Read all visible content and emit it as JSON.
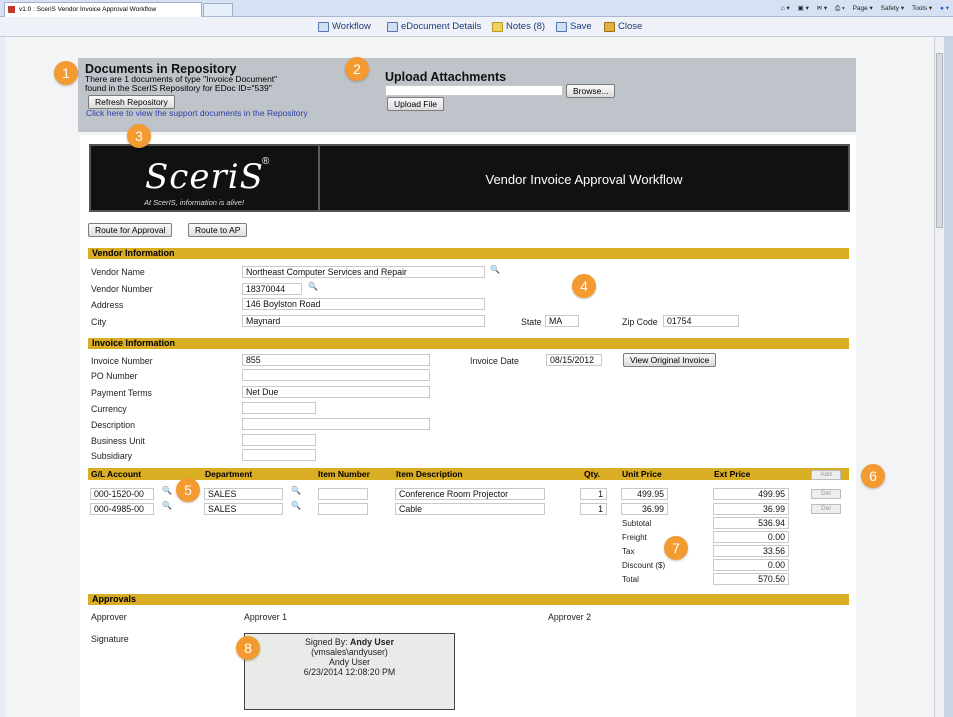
{
  "browser": {
    "tab_title": "v1.0 : SceriS Vendor Invoice Approval Workflow",
    "tools": [
      "Page ▾",
      "Safety ▾",
      "Tools ▾"
    ]
  },
  "toolbar": {
    "workflow": "Workflow",
    "edoc_details": "eDocument Details",
    "notes": "Notes (8)",
    "save": "Save",
    "close": "Close"
  },
  "repository": {
    "title": "Documents in Repository",
    "line1": "There are 1 documents of type \"Invoice Document\"",
    "line2": "found in the ScerIS Repository for EDoc ID=\"539\"",
    "refresh_button": "Refresh Repository",
    "link": "Click here to view the support documents in the Repository",
    "upload_title": "Upload Attachments",
    "browse_button": "Browse...",
    "upload_button": "Upload File"
  },
  "banner": {
    "logo": "SceriS",
    "registered": "®",
    "tagline": "At ScerIS, information is alive!",
    "title": "Vendor Invoice Approval Workflow"
  },
  "actions": {
    "route_approval": "Route for Approval",
    "route_ap": "Route to AP"
  },
  "vendor": {
    "section": "Vendor Information",
    "name_label": "Vendor Name",
    "name": "Northeast Computer Services and Repair",
    "number_label": "Vendor Number",
    "number": "18370044",
    "address_label": "Address",
    "address": "146 Boylston Road",
    "city_label": "City",
    "city": "Maynard",
    "state_label": "State",
    "state": "MA",
    "zip_label": "Zip Code",
    "zip": "01754"
  },
  "invoice": {
    "section": "Invoice Information",
    "number_label": "Invoice Number",
    "number": "855",
    "date_label": "Invoice Date",
    "date": "08/15/2012",
    "view_button": "View Original Invoice",
    "po_label": "PO Number",
    "po": "",
    "terms_label": "Payment Terms",
    "terms": "Net Due",
    "currency_label": "Currency",
    "currency": "",
    "description_label": "Description",
    "description": "",
    "unit_label": "Business Unit",
    "unit": "",
    "subsidiary_label": "Subsidiary",
    "subsidiary": ""
  },
  "lines": {
    "headers": {
      "gl": "G/L Account",
      "dept": "Department",
      "item": "Item Number",
      "desc": "Item Description",
      "qty": "Qty.",
      "unit": "Unit Price",
      "ext": "Ext Price",
      "add": "Add"
    },
    "rows": [
      {
        "gl": "000-1520-00",
        "dept": "SALES",
        "item": "",
        "desc": "Conference Room Projector",
        "qty": "1",
        "unit": "499.95",
        "ext": "499.95",
        "del": "Del"
      },
      {
        "gl": "000-4985-00",
        "dept": "SALES",
        "item": "",
        "desc": "Cable",
        "qty": "1",
        "unit": "36.99",
        "ext": "36.99",
        "del": "Del"
      }
    ],
    "totals": [
      {
        "label": "Subtotal",
        "value": "536.94"
      },
      {
        "label": "Freight",
        "value": "0.00"
      },
      {
        "label": "Tax",
        "value": "33.56"
      },
      {
        "label": "Discount ($)",
        "value": "0.00"
      },
      {
        "label": "Total",
        "value": "570.50"
      }
    ]
  },
  "approvals": {
    "section": "Approvals",
    "approver_label": "Approver",
    "approver1": "Approver 1",
    "approver2": "Approver 2",
    "signature_label": "Signature",
    "signed_by_prefix": "Signed By: ",
    "signed_by_name": "Andy User",
    "account": "(vmsales\\andyuser)",
    "name": "Andy User",
    "timestamp": "6/23/2014 12:08:20 PM"
  },
  "callouts": [
    "1",
    "2",
    "3",
    "4",
    "5",
    "6",
    "7",
    "8"
  ],
  "colors": {
    "section_bar": "#d9ad24",
    "callout": "#f39a30",
    "link": "#2c3ea6"
  }
}
